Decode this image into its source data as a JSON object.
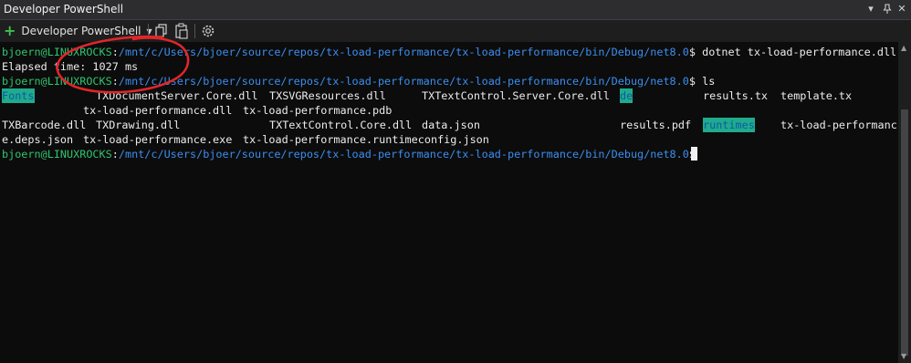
{
  "window": {
    "title": "Developer PowerShell"
  },
  "toolbar": {
    "profile_label": "Developer PowerShell"
  },
  "terminal": {
    "prompt": {
      "user": "bjoern@LINUXROCKS",
      "sep": ":",
      "path": "/mnt/c/Users/bjoer/source/repos/tx-load-performance/tx-load-performance/bin/Debug/net8.0",
      "dollar": "$ "
    },
    "cmd1": "dotnet tx-load-performance.dll",
    "output_elapsed": "Elapsed time: 1027 ms",
    "cmd2": "ls",
    "files": {
      "fonts": "Fonts",
      "txdocserver": "TXDocumentServer.Core.dll",
      "txsvg": "TXSVGResources.dll",
      "txtextserver": "TXTextControl.Server.Core.dll",
      "de": "de",
      "results_tx": "results.tx",
      "template_tx": "template.tx",
      "txload_dll": "tx-load-performance.dll",
      "txload_pdb": "tx-load-performance.pdb",
      "txbarcode": "TXBarcode.dll",
      "txdrawing": "TXDrawing.dll",
      "txtextcore": "TXTextControl.Core.dll",
      "data_json": "data.json",
      "results_pdf": "results.pdf",
      "runtimes": "runtimes",
      "txload_deps_a": "tx-load-performanc",
      "txload_deps_b": "e.deps.json",
      "txload_exe": "tx-load-performance.exe",
      "txload_rtconfig": "tx-load-performance.runtimeconfig.json"
    }
  }
}
